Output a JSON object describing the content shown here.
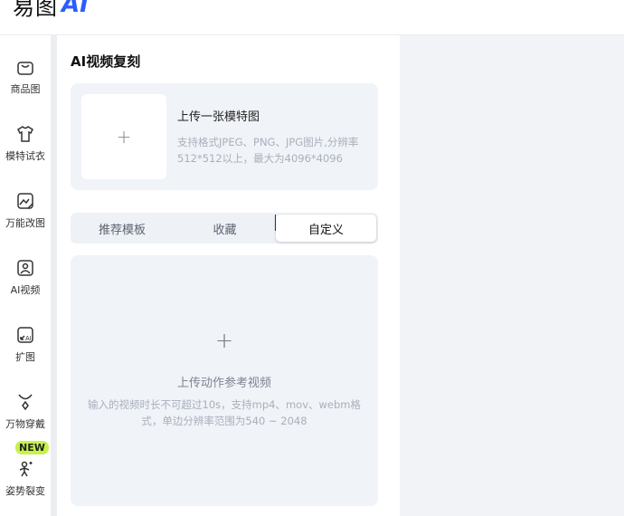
{
  "header": {
    "logo_text": "易图",
    "logo_ai": "AI"
  },
  "sidebar": {
    "items": [
      {
        "label": "商品图",
        "icon": "shopping-bag-icon"
      },
      {
        "label": "模特试衣",
        "icon": "tshirt-icon"
      },
      {
        "label": "万能改图",
        "icon": "image-edit-icon"
      },
      {
        "label": "AI视频",
        "icon": "video-icon"
      },
      {
        "label": "扩图",
        "icon": "expand-image-icon"
      },
      {
        "label": "万物穿戴",
        "icon": "pendant-icon"
      },
      {
        "label": "姿势裂变",
        "icon": "pose-icon"
      }
    ],
    "new_badge": "NEW"
  },
  "panel": {
    "title": "AI视频复刻",
    "upload": {
      "plus": "+",
      "title": "上传一张模特图",
      "desc": "支持格式JPEG、PNG、JPG图片,分辨率512*512以上，最大为4096*4096"
    },
    "tabs": [
      {
        "label": "推荐模板",
        "active": false
      },
      {
        "label": "收藏",
        "active": false
      },
      {
        "label": "自定义",
        "active": true
      }
    ],
    "video": {
      "plus": "+",
      "title": "上传动作参考视频",
      "desc": "输入的视频时长不可超过10s，支持mp4、mov、webm格式，单边分辨率范围为540 ~ 2048"
    }
  },
  "colors": {
    "accent": "#2b5cff",
    "badge": "#c6f24a",
    "card_bg": "#f0f3f8"
  }
}
